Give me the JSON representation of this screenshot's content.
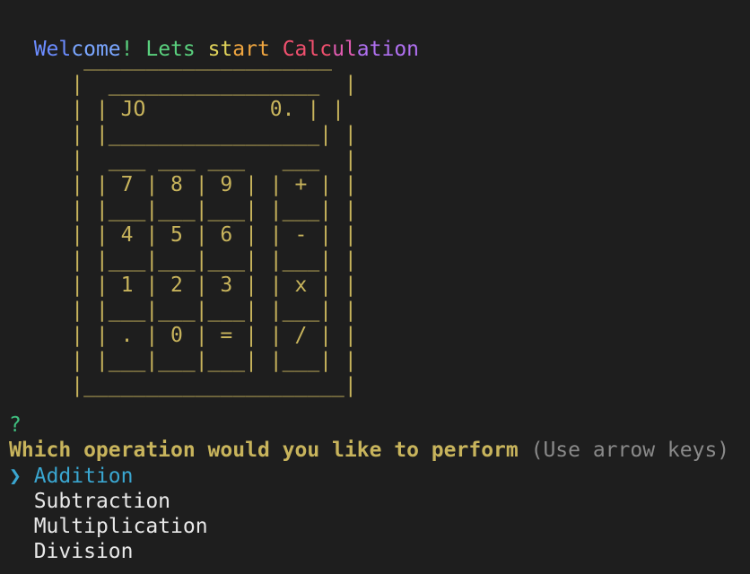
{
  "terminal": {
    "welcome_segments": [
      {
        "text": "Wel",
        "color": "#6b8cff"
      },
      {
        "text": "come",
        "color": "#7aa6ff"
      },
      {
        "text": "! ",
        "color": "#5ad17e"
      },
      {
        "text": "Lets",
        "color": "#5ad17e"
      },
      {
        "text": " st",
        "color": "#e0d35a"
      },
      {
        "text": "art",
        "color": "#f0a640"
      },
      {
        "text": " ",
        "color": "#e8e8e8"
      },
      {
        "text": "Calc",
        "color": "#f0506e"
      },
      {
        "text": "ul",
        "color": "#e05bb0"
      },
      {
        "text": "ation",
        "color": "#b070f0"
      }
    ],
    "ascii_art_color": "#c8b45c",
    "calculator_ascii": "      ____________________\n     |  _________________  |\n     | | JO          0. | |\n     | |_________________| |\n     |  ___ ___ ___   ___  |\n     | | 7 | 8 | 9 | | + | |\n     | |___|___|___| |___| |\n     | | 4 | 5 | 6 | | - | |\n     | |___|___|___| |___| |\n     | | 1 | 2 | 3 | | x | |\n     | |___|___|___| |___| |\n     | | . | 0 | = | | / | |\n     | |___|___|___| |___| |\n     |_____________________|",
    "prompt_symbol": "?",
    "question": "Which operation would you like to perform",
    "hint": "(Use arrow keys)",
    "pointer": "❯",
    "options": [
      {
        "label": "Addition",
        "selected": true
      },
      {
        "label": "Subtraction",
        "selected": false
      },
      {
        "label": "Multiplication",
        "selected": false
      },
      {
        "label": "Division",
        "selected": false
      }
    ]
  }
}
